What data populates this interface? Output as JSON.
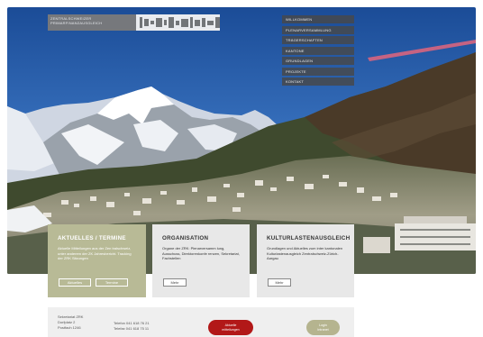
{
  "logo": {
    "line1": "ZENTRALSCHWEIZER",
    "line2": "PRIMARFINANZAUSGLEICH"
  },
  "nav": [
    "WILLKOMMEN",
    "PLENARVERSAMMLUNG",
    "TRÄGERSCHAFTEN",
    "KANTONE",
    "GRUNDLAGEN",
    "PROJEKTE",
    "KONTAKT"
  ],
  "cards": [
    {
      "title": "AKTUELLES / TERMINE",
      "text": "Aktuelle Mitteilungen aus der Zen tralschweiz, unter anderem der ZK Jahresbericht. Tracking der ZRK Sitzungen",
      "buttons": [
        "Aktuelles",
        "Termine"
      ]
    },
    {
      "title": "ORGANISATION",
      "text": "Organe der ZRK: Plenarversamm lung, Ausschuss, Direktorenkonfe renzen, Sekretariat, Fachstellen",
      "buttons": [
        "Mehr"
      ]
    },
    {
      "title": "KULTURLASTENAUSGLEICH",
      "text": "Grundlagen und Aktuelles zum inter kantonalen Kulturlastenausgleich Zentralschweiz-Zürich-Aargau",
      "buttons": [
        "Mehr"
      ]
    }
  ],
  "footer": {
    "addr1": "Sekretariat ZRK",
    "addr2": "Dorfplatz 2",
    "addr3": "Postfach 1246",
    "tel": "Telefon 041 618 76 21",
    "fax": "Telefax 041 618 75 11",
    "red_button_1": "Aktuelle",
    "red_button_2": "mitteilungen",
    "green_button_1": "Login",
    "green_button_2": "Intranet"
  }
}
